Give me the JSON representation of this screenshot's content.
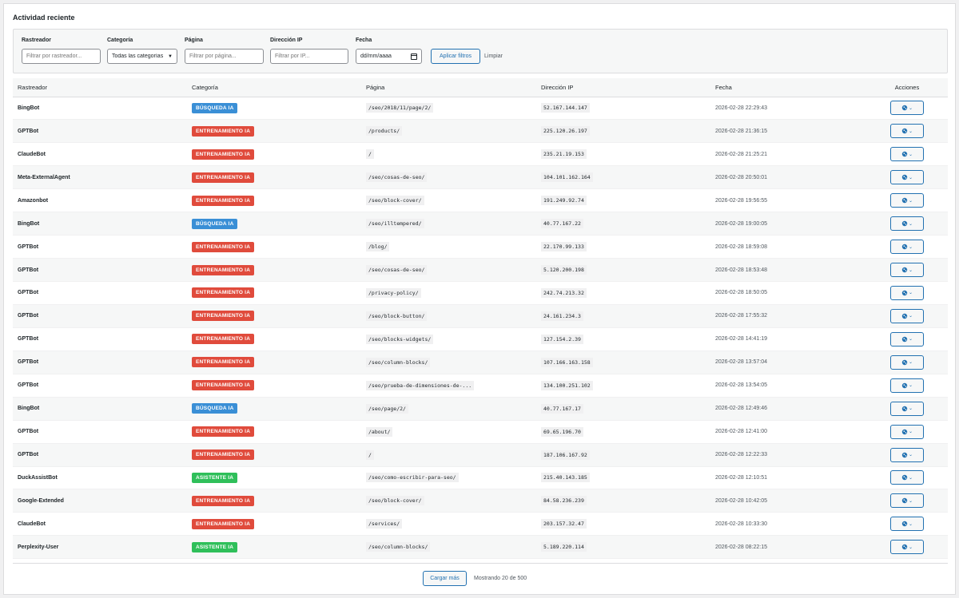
{
  "title": "Actividad reciente",
  "filters": {
    "crawler": {
      "label": "Rastreador",
      "placeholder": "Filtrar por rastreador..."
    },
    "category": {
      "label": "Categoría",
      "value": "Todas las categorías"
    },
    "page": {
      "label": "Página",
      "placeholder": "Filtrar por página..."
    },
    "ip": {
      "label": "Dirección IP",
      "placeholder": "Filtrar por IP..."
    },
    "date": {
      "label": "Fecha",
      "placeholder": "dd/mm/aaaa"
    },
    "apply_label": "Aplicar filtros",
    "clear_label": "Limpiar"
  },
  "columns": [
    "Rastreador",
    "Categoría",
    "Página",
    "Dirección IP",
    "Fecha",
    "Acciones"
  ],
  "category_colors": {
    "BÚSQUEDA IA": "#3a8fd6",
    "ENTRENAMIENTO IA": "#e04b3c",
    "ASISTENTE IA": "#2fbf5a"
  },
  "rows": [
    {
      "crawler": "BingBot",
      "category": "BÚSQUEDA IA",
      "page": "/seo/2018/11/page/2/",
      "ip": "52.167.144.147",
      "date": "2026-02-28 22:29:43"
    },
    {
      "crawler": "GPTBot",
      "category": "ENTRENAMIENTO IA",
      "page": "/products/",
      "ip": "225.120.26.197",
      "date": "2026-02-28 21:36:15"
    },
    {
      "crawler": "ClaudeBot",
      "category": "ENTRENAMIENTO IA",
      "page": "/",
      "ip": "235.21.19.153",
      "date": "2026-02-28 21:25:21"
    },
    {
      "crawler": "Meta-ExternalAgent",
      "category": "ENTRENAMIENTO IA",
      "page": "/seo/cosas-de-seo/",
      "ip": "104.101.162.164",
      "date": "2026-02-28 20:50:01"
    },
    {
      "crawler": "Amazonbot",
      "category": "ENTRENAMIENTO IA",
      "page": "/seo/block-cover/",
      "ip": "191.249.92.74",
      "date": "2026-02-28 19:56:55"
    },
    {
      "crawler": "BingBot",
      "category": "BÚSQUEDA IA",
      "page": "/seo/illtempered/",
      "ip": "40.77.167.22",
      "date": "2026-02-28 19:00:05"
    },
    {
      "crawler": "GPTBot",
      "category": "ENTRENAMIENTO IA",
      "page": "/blog/",
      "ip": "22.170.99.133",
      "date": "2026-02-28 18:59:08"
    },
    {
      "crawler": "GPTBot",
      "category": "ENTRENAMIENTO IA",
      "page": "/seo/cosas-de-seo/",
      "ip": "5.120.200.198",
      "date": "2026-02-28 18:53:48"
    },
    {
      "crawler": "GPTBot",
      "category": "ENTRENAMIENTO IA",
      "page": "/privacy-policy/",
      "ip": "242.74.213.32",
      "date": "2026-02-28 18:50:05"
    },
    {
      "crawler": "GPTBot",
      "category": "ENTRENAMIENTO IA",
      "page": "/seo/block-button/",
      "ip": "24.161.234.3",
      "date": "2026-02-28 17:55:32"
    },
    {
      "crawler": "GPTBot",
      "category": "ENTRENAMIENTO IA",
      "page": "/seo/blocks-widgets/",
      "ip": "127.154.2.39",
      "date": "2026-02-28 14:41:19"
    },
    {
      "crawler": "GPTBot",
      "category": "ENTRENAMIENTO IA",
      "page": "/seo/column-blocks/",
      "ip": "107.166.163.158",
      "date": "2026-02-28 13:57:04"
    },
    {
      "crawler": "GPTBot",
      "category": "ENTRENAMIENTO IA",
      "page": "/seo/prueba-de-dimensiones-de-...",
      "ip": "134.100.251.102",
      "date": "2026-02-28 13:54:05"
    },
    {
      "crawler": "BingBot",
      "category": "BÚSQUEDA IA",
      "page": "/seo/page/2/",
      "ip": "40.77.167.17",
      "date": "2026-02-28 12:49:46"
    },
    {
      "crawler": "GPTBot",
      "category": "ENTRENAMIENTO IA",
      "page": "/about/",
      "ip": "69.65.196.70",
      "date": "2026-02-28 12:41:00"
    },
    {
      "crawler": "GPTBot",
      "category": "ENTRENAMIENTO IA",
      "page": "/",
      "ip": "187.106.167.92",
      "date": "2026-02-28 12:22:33"
    },
    {
      "crawler": "DuckAssistBot",
      "category": "ASISTENTE IA",
      "page": "/seo/como-escribir-para-seo/",
      "ip": "215.40.143.185",
      "date": "2026-02-28 12:10:51"
    },
    {
      "crawler": "Google-Extended",
      "category": "ENTRENAMIENTO IA",
      "page": "/seo/block-cover/",
      "ip": "84.58.236.239",
      "date": "2026-02-28 10:42:05"
    },
    {
      "crawler": "ClaudeBot",
      "category": "ENTRENAMIENTO IA",
      "page": "/services/",
      "ip": "203.157.32.47",
      "date": "2026-02-28 10:33:30"
    },
    {
      "crawler": "Perplexity-User",
      "category": "ASISTENTE IA",
      "page": "/seo/column-blocks/",
      "ip": "5.189.220.114",
      "date": "2026-02-28 08:22:15"
    }
  ],
  "row_action_icon": "globe-dropdown-icon",
  "pagination": {
    "load_more_label": "Cargar más",
    "count_text": "Mostrando 20 de 500"
  }
}
